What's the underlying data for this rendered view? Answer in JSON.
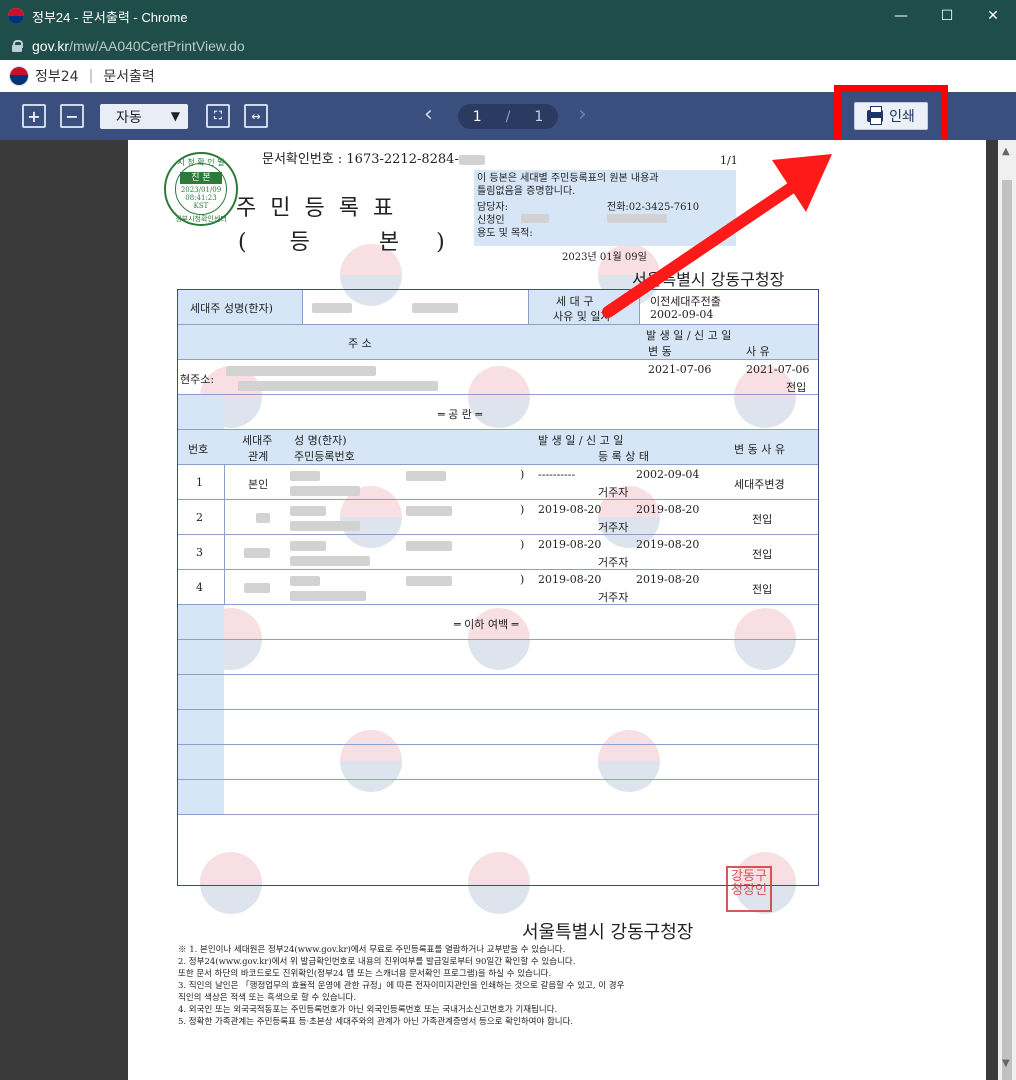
{
  "window": {
    "title": "정부24 - 문서출력 - Chrome",
    "min": "—",
    "max": "☐",
    "close": "✕"
  },
  "address": {
    "host": "gov.kr",
    "path": "/mw/AA040CertPrintView.do"
  },
  "site": {
    "name": "정부24",
    "section": "문서출력"
  },
  "toolbar": {
    "zoom_in": "+",
    "zoom_out": "−",
    "zoom_value": "자동",
    "prev": "‹",
    "next": "›",
    "page_current": "1",
    "page_sep": "/",
    "page_total": "1",
    "print_label": "인쇄"
  },
  "doc": {
    "doc_no_label": "문서확인번호 : 1673-2212-8284-",
    "page_no": "1/1",
    "title": "주민등록표",
    "sub_left": "(",
    "sub_a": "등",
    "sub_b": "본",
    "sub_right": ")",
    "stamp_top": "시 청 확 인 필",
    "stamp_mid": "진 본",
    "stamp_date": "2023/01/09",
    "stamp_time": "08:41:23",
    "stamp_tz": "KST",
    "stamp_bottom": "정부시청확인센터",
    "info_line1": "이 등본은 세대별 주민등록표의 원본 내용과",
    "info_line2": "틀림없음을 증명합니다.",
    "info_manager": "담당자:",
    "info_phone": "전화:02-3425-7610",
    "info_applicant": "신청인",
    "info_purpose": "용도 및 목적:",
    "issue_date": "2023년 01월 09일",
    "office": "서울특별시 강동구청장",
    "head_label": "세대주 성명(한자)",
    "reason_label1": "세 대 구",
    "reason_label2": "사유 및 일자",
    "reason_value": "이전세대주전출",
    "reason_date": "2002-09-04",
    "addr_header": "주                  소",
    "addr_h_right1": "발 생 일  /  신 고 일",
    "addr_h_right2a": "변       동",
    "addr_h_right2b": "사     유",
    "current_addr_label": "현주소:",
    "addr_date1": "2021-07-06",
    "addr_date2": "2021-07-06",
    "addr_reason": "전입",
    "blank_row": "═   공   란   ═",
    "col_no": "번호",
    "col_rel1": "세대주",
    "col_rel2": "관계",
    "col_name1": "성  명(한자)",
    "col_name2": "주민등록번호",
    "col_date1": "발 생 일  /  신 고 일",
    "col_date2": "등 록 상 태",
    "col_change": "변 동 사 유",
    "members": [
      {
        "no": "1",
        "rel": "본인",
        "d1": "----------",
        "d2": "2002-09-04",
        "status": "거주자",
        "change": "세대주변경"
      },
      {
        "no": "2",
        "rel": "",
        "d1": "2019-08-20",
        "d2": "2019-08-20",
        "status": "거주자",
        "change": "전입"
      },
      {
        "no": "3",
        "rel": "",
        "d1": "2019-08-20",
        "d2": "2019-08-20",
        "status": "거주자",
        "change": "전입"
      },
      {
        "no": "4",
        "rel": "",
        "d1": "2019-08-20",
        "d2": "2019-08-20",
        "status": "거주자",
        "change": "전입"
      }
    ],
    "end_label": "═ 이하 여백 ═",
    "seal_text": "강동구청장인",
    "office_bottom": "서울특별시 강동구청장",
    "notes": [
      "※ 1. 본인이나 세대원은 정부24(www.gov.kr)에서 무료로 주민등록표를 열람하거나 교부받을 수 있습니다.",
      "   2. 정부24(www.gov.kr)에서 위 발급확인번호로 내용의 진위여부를 발급일로부터 90일간 확인할 수 있습니다.",
      "      또한 문서 하단의 바코드로도 진위확인(정부24 앱 또는 스캐너용 문서확인 프로그램)을 하실 수 있습니다.",
      "   3. 직인의 날인은 「행정업무의 효율적 운영에 관한 규정」에 따른 전자이미지관인을 인쇄하는 것으로 갈음할 수 있고, 이 경우",
      "      직인의 색상은 적색 또는 흑색으로 할 수 있습니다.",
      "   4. 외국인 또는 외국국적동포는 주민등록번호가 아닌 외국인등록번호 또는 국내거소신고번호가 기재됩니다.",
      "   5. 정확한 가족관계는 주민등록표 등·초본상 세대주와의 관계가 아닌 가족관계증명서 등으로 확인하여야 합니다."
    ]
  },
  "colors": {
    "titlebar": "#1f4e4a",
    "toolbar": "#3a4f7e",
    "header_fill": "#d7e6f7",
    "highlight": "#ff0000"
  }
}
